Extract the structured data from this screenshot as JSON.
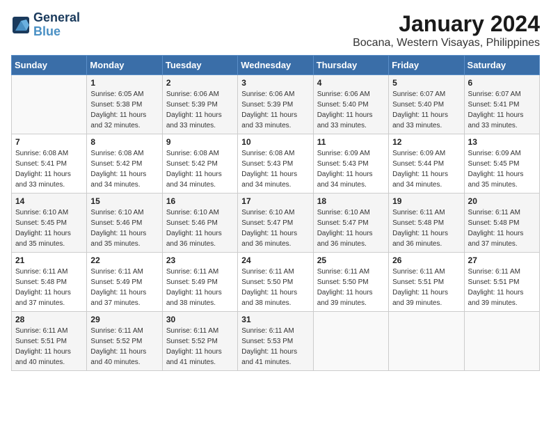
{
  "logo": {
    "line1": "General",
    "line2": "Blue"
  },
  "title": "January 2024",
  "subtitle": "Bocana, Western Visayas, Philippines",
  "headers": [
    "Sunday",
    "Monday",
    "Tuesday",
    "Wednesday",
    "Thursday",
    "Friday",
    "Saturday"
  ],
  "weeks": [
    [
      {
        "day": "",
        "sunrise": "",
        "sunset": "",
        "daylight": ""
      },
      {
        "day": "1",
        "sunrise": "Sunrise: 6:05 AM",
        "sunset": "Sunset: 5:38 PM",
        "daylight": "Daylight: 11 hours and 32 minutes."
      },
      {
        "day": "2",
        "sunrise": "Sunrise: 6:06 AM",
        "sunset": "Sunset: 5:39 PM",
        "daylight": "Daylight: 11 hours and 33 minutes."
      },
      {
        "day": "3",
        "sunrise": "Sunrise: 6:06 AM",
        "sunset": "Sunset: 5:39 PM",
        "daylight": "Daylight: 11 hours and 33 minutes."
      },
      {
        "day": "4",
        "sunrise": "Sunrise: 6:06 AM",
        "sunset": "Sunset: 5:40 PM",
        "daylight": "Daylight: 11 hours and 33 minutes."
      },
      {
        "day": "5",
        "sunrise": "Sunrise: 6:07 AM",
        "sunset": "Sunset: 5:40 PM",
        "daylight": "Daylight: 11 hours and 33 minutes."
      },
      {
        "day": "6",
        "sunrise": "Sunrise: 6:07 AM",
        "sunset": "Sunset: 5:41 PM",
        "daylight": "Daylight: 11 hours and 33 minutes."
      }
    ],
    [
      {
        "day": "7",
        "sunrise": "Sunrise: 6:08 AM",
        "sunset": "Sunset: 5:41 PM",
        "daylight": "Daylight: 11 hours and 33 minutes."
      },
      {
        "day": "8",
        "sunrise": "Sunrise: 6:08 AM",
        "sunset": "Sunset: 5:42 PM",
        "daylight": "Daylight: 11 hours and 34 minutes."
      },
      {
        "day": "9",
        "sunrise": "Sunrise: 6:08 AM",
        "sunset": "Sunset: 5:42 PM",
        "daylight": "Daylight: 11 hours and 34 minutes."
      },
      {
        "day": "10",
        "sunrise": "Sunrise: 6:08 AM",
        "sunset": "Sunset: 5:43 PM",
        "daylight": "Daylight: 11 hours and 34 minutes."
      },
      {
        "day": "11",
        "sunrise": "Sunrise: 6:09 AM",
        "sunset": "Sunset: 5:43 PM",
        "daylight": "Daylight: 11 hours and 34 minutes."
      },
      {
        "day": "12",
        "sunrise": "Sunrise: 6:09 AM",
        "sunset": "Sunset: 5:44 PM",
        "daylight": "Daylight: 11 hours and 34 minutes."
      },
      {
        "day": "13",
        "sunrise": "Sunrise: 6:09 AM",
        "sunset": "Sunset: 5:45 PM",
        "daylight": "Daylight: 11 hours and 35 minutes."
      }
    ],
    [
      {
        "day": "14",
        "sunrise": "Sunrise: 6:10 AM",
        "sunset": "Sunset: 5:45 PM",
        "daylight": "Daylight: 11 hours and 35 minutes."
      },
      {
        "day": "15",
        "sunrise": "Sunrise: 6:10 AM",
        "sunset": "Sunset: 5:46 PM",
        "daylight": "Daylight: 11 hours and 35 minutes."
      },
      {
        "day": "16",
        "sunrise": "Sunrise: 6:10 AM",
        "sunset": "Sunset: 5:46 PM",
        "daylight": "Daylight: 11 hours and 36 minutes."
      },
      {
        "day": "17",
        "sunrise": "Sunrise: 6:10 AM",
        "sunset": "Sunset: 5:47 PM",
        "daylight": "Daylight: 11 hours and 36 minutes."
      },
      {
        "day": "18",
        "sunrise": "Sunrise: 6:10 AM",
        "sunset": "Sunset: 5:47 PM",
        "daylight": "Daylight: 11 hours and 36 minutes."
      },
      {
        "day": "19",
        "sunrise": "Sunrise: 6:11 AM",
        "sunset": "Sunset: 5:48 PM",
        "daylight": "Daylight: 11 hours and 36 minutes."
      },
      {
        "day": "20",
        "sunrise": "Sunrise: 6:11 AM",
        "sunset": "Sunset: 5:48 PM",
        "daylight": "Daylight: 11 hours and 37 minutes."
      }
    ],
    [
      {
        "day": "21",
        "sunrise": "Sunrise: 6:11 AM",
        "sunset": "Sunset: 5:48 PM",
        "daylight": "Daylight: 11 hours and 37 minutes."
      },
      {
        "day": "22",
        "sunrise": "Sunrise: 6:11 AM",
        "sunset": "Sunset: 5:49 PM",
        "daylight": "Daylight: 11 hours and 37 minutes."
      },
      {
        "day": "23",
        "sunrise": "Sunrise: 6:11 AM",
        "sunset": "Sunset: 5:49 PM",
        "daylight": "Daylight: 11 hours and 38 minutes."
      },
      {
        "day": "24",
        "sunrise": "Sunrise: 6:11 AM",
        "sunset": "Sunset: 5:50 PM",
        "daylight": "Daylight: 11 hours and 38 minutes."
      },
      {
        "day": "25",
        "sunrise": "Sunrise: 6:11 AM",
        "sunset": "Sunset: 5:50 PM",
        "daylight": "Daylight: 11 hours and 39 minutes."
      },
      {
        "day": "26",
        "sunrise": "Sunrise: 6:11 AM",
        "sunset": "Sunset: 5:51 PM",
        "daylight": "Daylight: 11 hours and 39 minutes."
      },
      {
        "day": "27",
        "sunrise": "Sunrise: 6:11 AM",
        "sunset": "Sunset: 5:51 PM",
        "daylight": "Daylight: 11 hours and 39 minutes."
      }
    ],
    [
      {
        "day": "28",
        "sunrise": "Sunrise: 6:11 AM",
        "sunset": "Sunset: 5:51 PM",
        "daylight": "Daylight: 11 hours and 40 minutes."
      },
      {
        "day": "29",
        "sunrise": "Sunrise: 6:11 AM",
        "sunset": "Sunset: 5:52 PM",
        "daylight": "Daylight: 11 hours and 40 minutes."
      },
      {
        "day": "30",
        "sunrise": "Sunrise: 6:11 AM",
        "sunset": "Sunset: 5:52 PM",
        "daylight": "Daylight: 11 hours and 41 minutes."
      },
      {
        "day": "31",
        "sunrise": "Sunrise: 6:11 AM",
        "sunset": "Sunset: 5:53 PM",
        "daylight": "Daylight: 11 hours and 41 minutes."
      },
      {
        "day": "",
        "sunrise": "",
        "sunset": "",
        "daylight": ""
      },
      {
        "day": "",
        "sunrise": "",
        "sunset": "",
        "daylight": ""
      },
      {
        "day": "",
        "sunrise": "",
        "sunset": "",
        "daylight": ""
      }
    ]
  ]
}
